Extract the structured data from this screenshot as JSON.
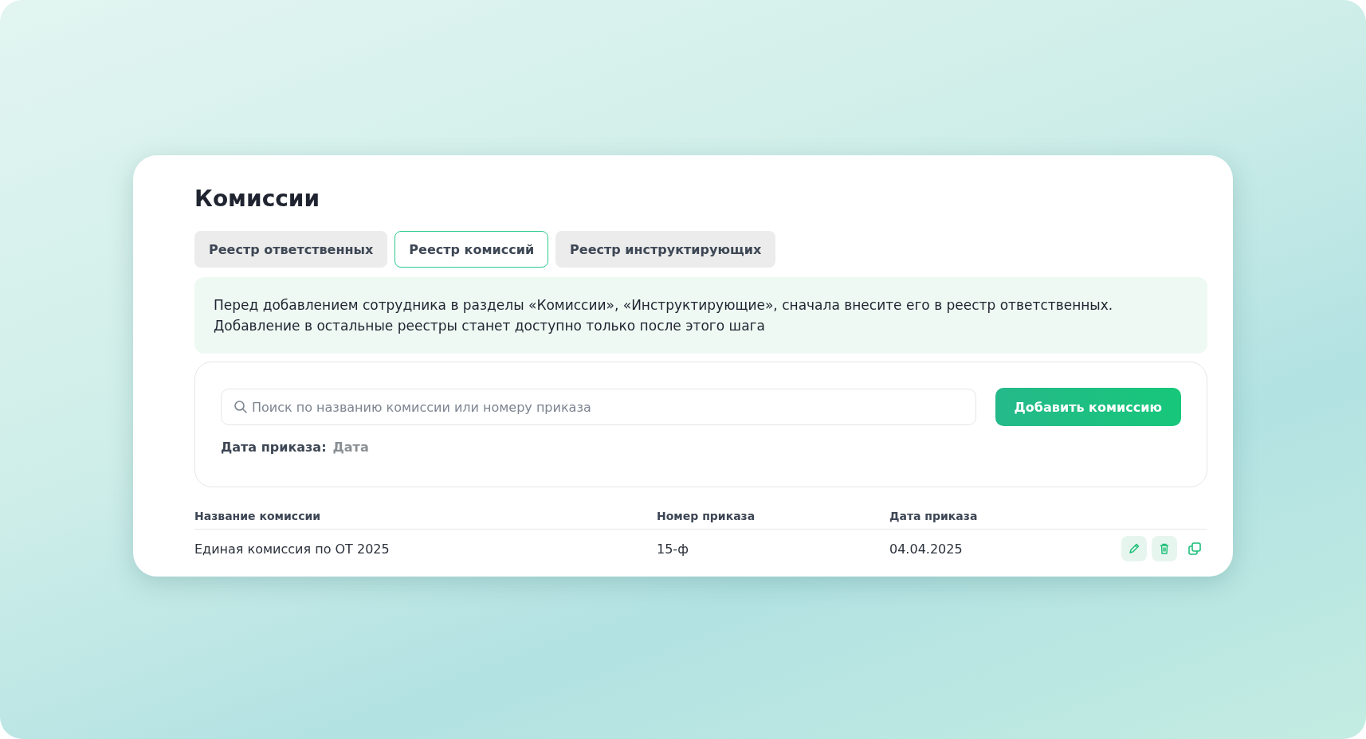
{
  "page": {
    "title": "Комиссии"
  },
  "tabs": [
    {
      "label": "Реестр ответственных",
      "selected": false
    },
    {
      "label": "Реестр комиссий",
      "selected": true
    },
    {
      "label": "Реестр инструктирующих",
      "selected": false
    }
  ],
  "notice": {
    "lines": [
      "Перед добавлением сотрудника в разделы «Комиссии», «Инструктирующие», сначала внесите его в реестр ответственных.",
      "Добавление в остальные реестры станет доступно только после этого шага"
    ]
  },
  "filters": {
    "search": {
      "placeholder": "Поиск по названию комиссии или номеру приказа"
    },
    "add_button": "Добавить комиссию",
    "date_filter": {
      "label": "Дата приказа:",
      "value": "Дата"
    }
  },
  "table": {
    "columns": [
      "Название комиссии",
      "Номер приказа",
      "Дата приказа"
    ],
    "rows": [
      {
        "cells": [
          "Единая комиссия по ОТ 2025",
          "15-ф",
          "04.04.2025"
        ]
      }
    ]
  }
}
